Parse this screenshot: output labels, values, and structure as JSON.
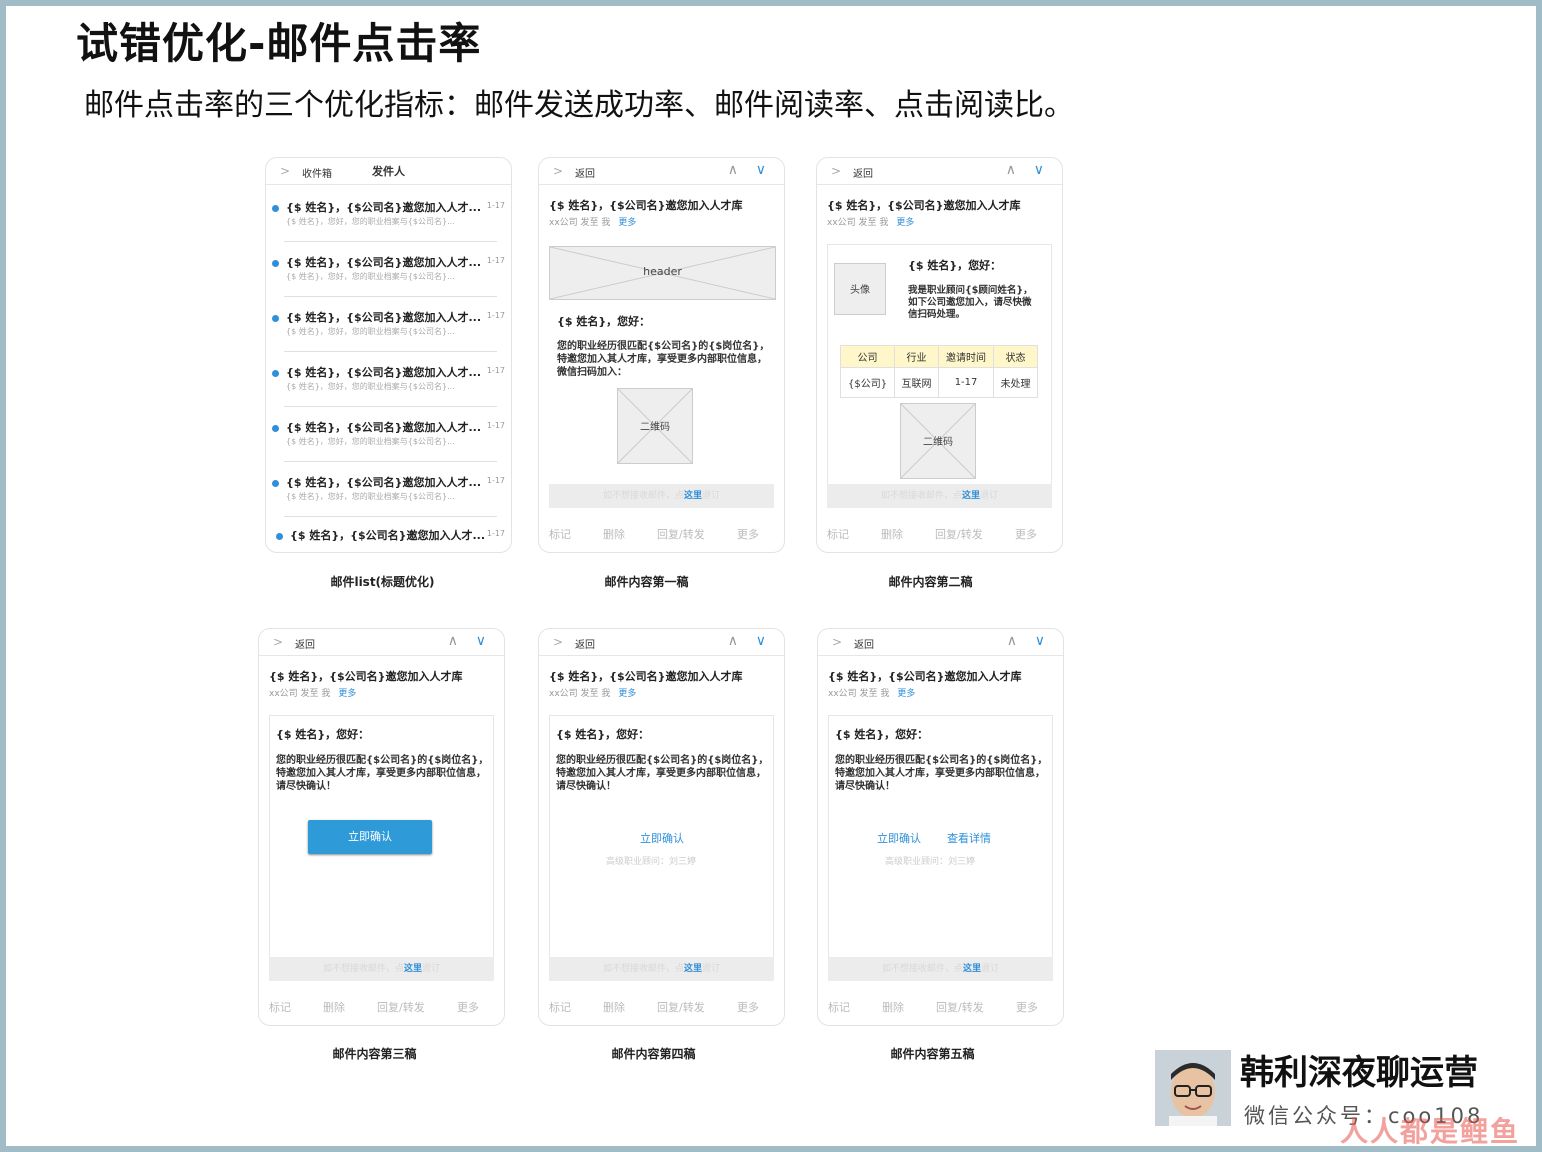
{
  "slide": {
    "title": "试错优化-邮件点击率",
    "subtitle": "邮件点击率的三个优化指标：邮件发送成功率、邮件阅读率、点击阅读比。"
  },
  "common": {
    "back": "返回",
    "inbox": "收件箱",
    "sender": "发件人",
    "subject": "{$ 姓名}，{$公司名}邀您加入人才库",
    "list_subject": "{$ 姓名}，{$公司名}邀您加入人才...",
    "list_date": "1-17",
    "list_snippet": "{$ 姓名}，您好，您的职业档案与{$公司名}...",
    "meta_from": "xx公司  发至  我",
    "meta_more": "更多",
    "header_placeholder": "header",
    "greeting": "{$ 姓名}，您好：",
    "body_scan": "您的职业经历很匹配{$公司名}的{$岗位名}，特邀您加入其人才库，享受更多内部职位信息，微信扫码加入：",
    "body_confirm": "您的职业经历很匹配{$公司名}的{$岗位名}，特邀您加入其人才库，享受更多内部职位信息，请尽快确认！",
    "qr": "二维码",
    "avatar_label": "头像",
    "advisor_text": "我是职业顾问{$顾问姓名}，如下公司邀您加入，请尽快微信扫码处理。",
    "unsub_prefix": "如不想接收邮件，点",
    "unsub_link": "这里",
    "unsub_suffix": "退订",
    "confirm": "立即确认",
    "details": "查看详情",
    "signature": "高级职业顾问：刘三婷",
    "bar_mark": "标记",
    "bar_delete": "删除",
    "bar_reply": "回复/转发",
    "bar_more": "更多"
  },
  "table": {
    "headers": [
      "公司",
      "行业",
      "邀请时间",
      "状态"
    ],
    "row": [
      "{$公司}",
      "互联网",
      "1-17",
      "未处理"
    ]
  },
  "captions": {
    "list": "邮件list(标题优化)",
    "d1": "邮件内容第一稿",
    "d2": "邮件内容第二稿",
    "d3": "邮件内容第三稿",
    "d4": "邮件内容第四稿",
    "d5": "邮件内容第五稿"
  },
  "footer": {
    "brand": "韩利深夜聊运营",
    "wechat": "微信公众号：coo108",
    "watermark": "人人都是鲤鱼"
  },
  "colors": {
    "accent": "#2f8fd8",
    "frame": "#9fbcc7",
    "table_header": "#fff6c9"
  }
}
